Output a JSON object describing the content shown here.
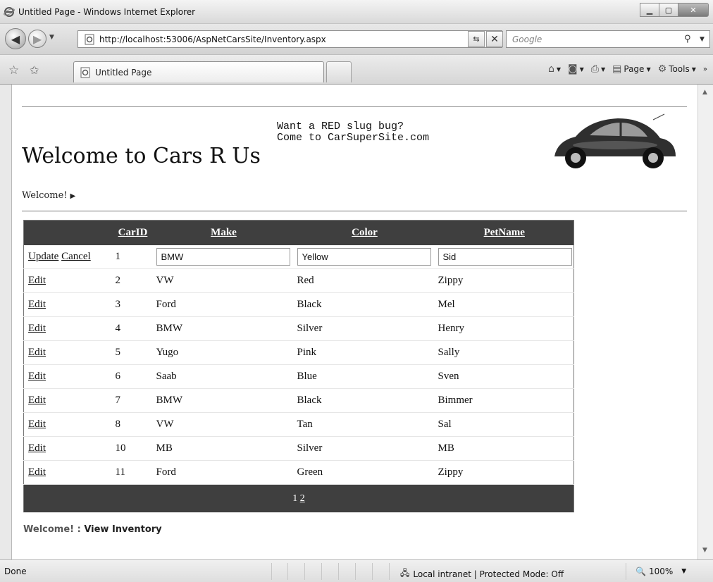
{
  "window": {
    "title": "Untitled Page - Windows Internet Explorer",
    "minimize": "▁",
    "maximize": "▢",
    "close": "✕"
  },
  "address": {
    "url": "http://localhost:53006/AspNetCarsSite/Inventory.aspx",
    "search_placeholder": "Google"
  },
  "tabs": {
    "active_label": "Untitled Page",
    "commands": {
      "page": "Page",
      "tools": "Tools"
    }
  },
  "page": {
    "site_title": "Welcome to Cars R Us",
    "ad_line1": "Want a RED slug bug?",
    "ad_line2": "Come to CarSuperSite.com",
    "sitepath": "Welcome!",
    "footer_root": "Welcome! : ",
    "footer_current": "View Inventory"
  },
  "grid": {
    "columns": [
      "",
      "CarID",
      "Make",
      "Color",
      "PetName"
    ],
    "edit_row": {
      "update": "Update",
      "cancel": "Cancel",
      "carid": "1",
      "make": "BMW",
      "color": "Yellow",
      "petname": "Sid"
    },
    "edit_label": "Edit",
    "rows": [
      {
        "carid": "2",
        "make": "VW",
        "color": "Red",
        "petname": "Zippy"
      },
      {
        "carid": "3",
        "make": "Ford",
        "color": "Black",
        "petname": "Mel"
      },
      {
        "carid": "4",
        "make": "BMW",
        "color": "Silver",
        "petname": "Henry"
      },
      {
        "carid": "5",
        "make": "Yugo",
        "color": "Pink",
        "petname": "Sally"
      },
      {
        "carid": "6",
        "make": "Saab",
        "color": "Blue",
        "petname": "Sven"
      },
      {
        "carid": "7",
        "make": "BMW",
        "color": "Black",
        "petname": "Bimmer"
      },
      {
        "carid": "8",
        "make": "VW",
        "color": "Tan",
        "petname": "Sal"
      },
      {
        "carid": "10",
        "make": "MB",
        "color": "Silver",
        "petname": "MB"
      },
      {
        "carid": "11",
        "make": "Ford",
        "color": "Green",
        "petname": "Zippy"
      }
    ],
    "pager": {
      "current": "1",
      "next": "2"
    }
  },
  "status": {
    "text": "Done",
    "zone": "Local intranet | Protected Mode: Off",
    "zoom": "100%"
  },
  "colors": {
    "grid_header": "#3f3f3f",
    "page_bg": "#ffffff"
  }
}
